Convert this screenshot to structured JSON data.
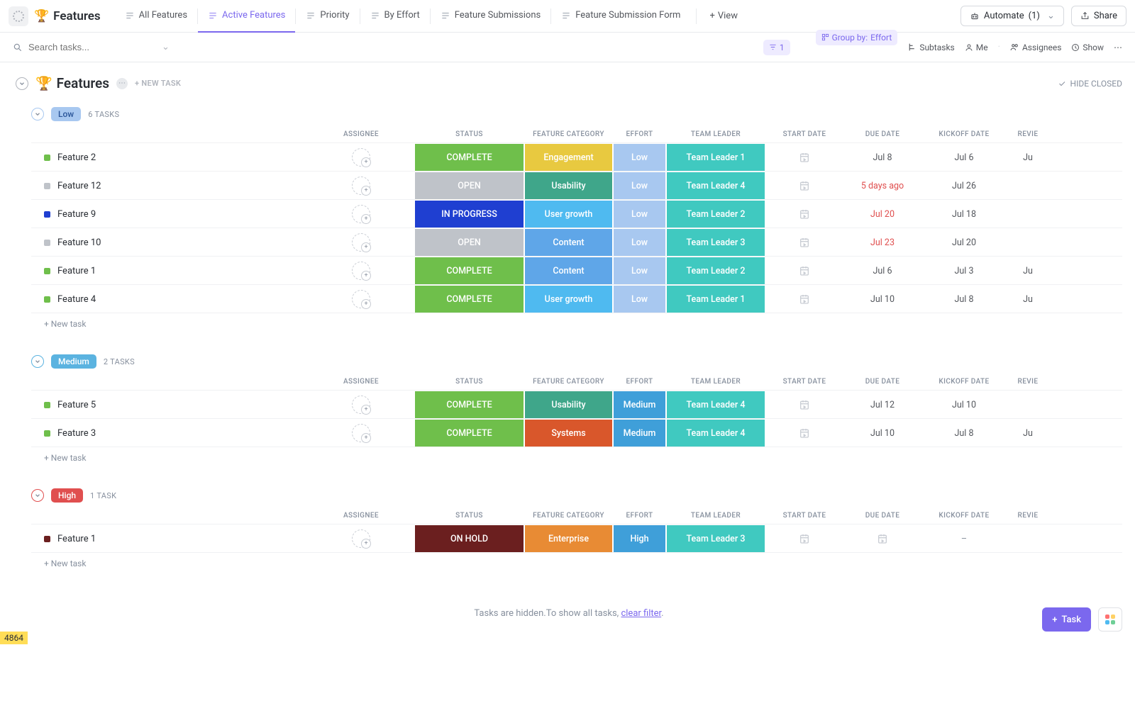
{
  "header": {
    "title": "Features",
    "trophy": "🏆",
    "tabs": [
      {
        "label": "All Features",
        "active": false
      },
      {
        "label": "Active Features",
        "active": true
      },
      {
        "label": "Priority",
        "active": false
      },
      {
        "label": "By Effort",
        "active": false
      },
      {
        "label": "Feature Submissions",
        "active": false
      },
      {
        "label": "Feature Submission Form",
        "active": false
      }
    ],
    "view_add": "View",
    "automate_label": "Automate",
    "automate_count": "(1)",
    "share": "Share"
  },
  "filterbar": {
    "search_placeholder": "Search tasks...",
    "filter_count": "1",
    "group_by_label": "Group by:",
    "group_by_value": "Effort",
    "subtasks": "Subtasks",
    "me": "Me",
    "assignees": "Assignees",
    "show": "Show"
  },
  "list": {
    "title": "Features",
    "new_task_inline": "+ NEW TASK",
    "hide_closed": "HIDE CLOSED"
  },
  "columns": [
    "ASSIGNEE",
    "STATUS",
    "FEATURE CATEGORY",
    "EFFORT",
    "TEAM LEADER",
    "START DATE",
    "DUE DATE",
    "KICKOFF DATE",
    "REVIE"
  ],
  "status_colors": {
    "COMPLETE": {
      "bg": "#6fbf4b",
      "dot": "#6fbf4b"
    },
    "OPEN": {
      "bg": "#bfc3c9",
      "dot": "#bfc3c9"
    },
    "IN PROGRESS": {
      "bg": "#1f3fd1",
      "dot": "#1f3fd1"
    },
    "ON HOLD": {
      "bg": "#6b1f1f",
      "dot": "#6b1f1f"
    }
  },
  "category_colors": {
    "Engagement": "#e8c940",
    "Usability": "#3fa68a",
    "User growth": "#4fbaf0",
    "Content": "#5fa6e8",
    "Systems": "#d9572b",
    "Enterprise": "#e88b34"
  },
  "effort_colors": {
    "Low": "#a8c8f0",
    "Medium": "#3f9fd9",
    "High": "#3f9fd9"
  },
  "leader_color": "#40c9c0",
  "groups": [
    {
      "name": "Low",
      "pill_class": "low",
      "count": "6 TASKS",
      "tasks": [
        {
          "name": "Feature 2",
          "status": "COMPLETE",
          "category": "Engagement",
          "effort": "Low",
          "leader": "Team Leader 1",
          "start": "",
          "due": "Jul 8",
          "due_overdue": false,
          "kickoff": "Jul 6",
          "review": "Ju"
        },
        {
          "name": "Feature 12",
          "status": "OPEN",
          "category": "Usability",
          "effort": "Low",
          "leader": "Team Leader 4",
          "start": "",
          "due": "5 days ago",
          "due_overdue": true,
          "kickoff": "Jul 26",
          "review": ""
        },
        {
          "name": "Feature 9",
          "status": "IN PROGRESS",
          "category": "User growth",
          "effort": "Low",
          "leader": "Team Leader 2",
          "start": "",
          "due": "Jul 20",
          "due_overdue": true,
          "kickoff": "Jul 18",
          "review": ""
        },
        {
          "name": "Feature 10",
          "status": "OPEN",
          "category": "Content",
          "effort": "Low",
          "leader": "Team Leader 3",
          "start": "",
          "due": "Jul 23",
          "due_overdue": true,
          "kickoff": "Jul 20",
          "review": ""
        },
        {
          "name": "Feature 1",
          "status": "COMPLETE",
          "category": "Content",
          "effort": "Low",
          "leader": "Team Leader 2",
          "start": "",
          "due": "Jul 6",
          "due_overdue": false,
          "kickoff": "Jul 3",
          "review": "Ju"
        },
        {
          "name": "Feature 4",
          "status": "COMPLETE",
          "category": "User growth",
          "effort": "Low",
          "leader": "Team Leader 1",
          "start": "",
          "due": "Jul 10",
          "due_overdue": false,
          "kickoff": "Jul 8",
          "review": "Ju"
        }
      ]
    },
    {
      "name": "Medium",
      "pill_class": "medium",
      "count": "2 TASKS",
      "tasks": [
        {
          "name": "Feature 5",
          "status": "COMPLETE",
          "category": "Usability",
          "effort": "Medium",
          "leader": "Team Leader 4",
          "start": "",
          "due": "Jul 12",
          "due_overdue": false,
          "kickoff": "Jul 10",
          "review": ""
        },
        {
          "name": "Feature 3",
          "status": "COMPLETE",
          "category": "Systems",
          "effort": "Medium",
          "leader": "Team Leader 4",
          "start": "",
          "due": "Jul 10",
          "due_overdue": false,
          "kickoff": "Jul 8",
          "review": "Ju"
        }
      ]
    },
    {
      "name": "High",
      "pill_class": "high",
      "count": "1 TASK",
      "tasks": [
        {
          "name": "Feature 1",
          "status": "ON HOLD",
          "category": "Enterprise",
          "effort": "High",
          "leader": "Team Leader 3",
          "start": "",
          "due": "",
          "due_overdue": false,
          "kickoff": "–",
          "review": ""
        }
      ]
    }
  ],
  "new_task_row": "+ New task",
  "hidden_msg_a": "Tasks are hidden.",
  "hidden_msg_b": "To show all tasks, ",
  "hidden_msg_link": "clear filter",
  "fab_task": "Task",
  "corner_badge": "4864"
}
